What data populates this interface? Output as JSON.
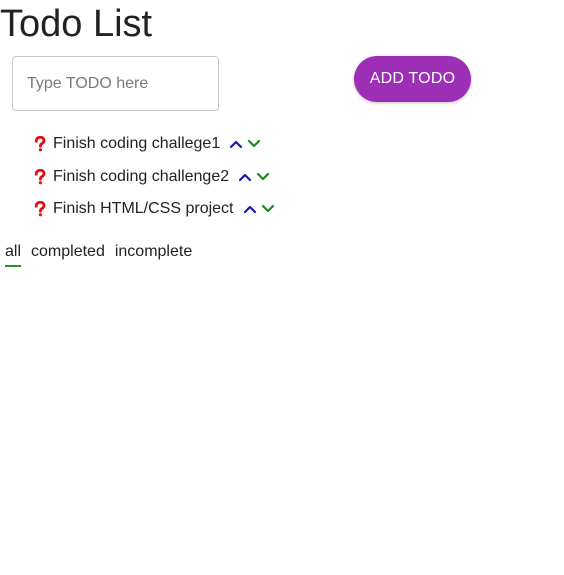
{
  "page": {
    "title": "Todo List"
  },
  "form": {
    "input_placeholder": "Type TODO here",
    "input_value": "",
    "add_button_label": "ADD TODO"
  },
  "todos": [
    {
      "text": "Finish coding challege1",
      "status_icon": "question-mark-icon"
    },
    {
      "text": "Finish coding challenge2",
      "status_icon": "question-mark-icon"
    },
    {
      "text": "Finish HTML/CSS project",
      "status_icon": "question-mark-icon"
    }
  ],
  "filters": {
    "tabs": [
      "all",
      "completed",
      "incomplete"
    ],
    "active": "all"
  },
  "colors": {
    "accent_button": "#9c2fb5",
    "status_icon": "#e01010",
    "move_up": "#1a1aa8",
    "move_down": "#1a8a1a",
    "active_tab_underline": "#2e8b2e"
  }
}
